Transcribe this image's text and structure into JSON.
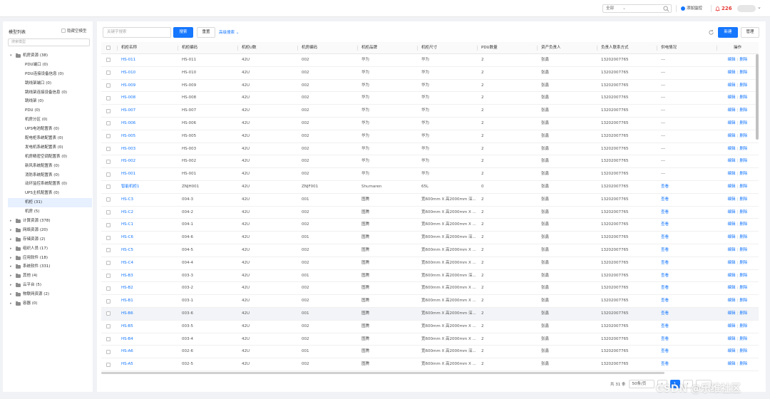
{
  "topbar": {
    "select_label": "全部",
    "add_label": "添加监控",
    "alarm_count": "226",
    "colors": {
      "accent": "#1677ff",
      "alarm": "#e53935"
    }
  },
  "left": {
    "title": "模型列表",
    "hide_empty": "隐藏空模型",
    "search_placeholder": "搜索模型",
    "tree": [
      {
        "label": "机房资源 (38)",
        "level": 0,
        "expanded": true
      },
      {
        "label": "PDU端口 (0)",
        "level": 1
      },
      {
        "label": "PDU连接设备信息 (0)",
        "level": 1
      },
      {
        "label": "跳线架端口 (0)",
        "level": 1
      },
      {
        "label": "跳线架连接设备信息 (0)",
        "level": 1
      },
      {
        "label": "跳线架 (0)",
        "level": 1
      },
      {
        "label": "PDU (0)",
        "level": 1
      },
      {
        "label": "机房分区 (0)",
        "level": 1
      },
      {
        "label": "UPS电池配置表 (0)",
        "level": 1
      },
      {
        "label": "配电柜系统配置表 (0)",
        "level": 1
      },
      {
        "label": "发电机系统配置表 (0)",
        "level": 1
      },
      {
        "label": "机房精密空调配置表 (0)",
        "level": 1
      },
      {
        "label": "新风系统配置表 (0)",
        "level": 1
      },
      {
        "label": "消防系统配置表 (0)",
        "level": 1
      },
      {
        "label": "动环监控系统配置表 (0)",
        "level": 1
      },
      {
        "label": "UPS主机配置表 (0)",
        "level": 1
      },
      {
        "label": "机柜 (31)",
        "level": 1,
        "selected": true
      },
      {
        "label": "机房 (5)",
        "level": 1
      },
      {
        "label": "计算资源 (378)",
        "level": 0
      },
      {
        "label": "网络资源 (20)",
        "level": 0
      },
      {
        "label": "存储资源 (2)",
        "level": 0
      },
      {
        "label": "组织人员 (17)",
        "level": 0
      },
      {
        "label": "应用软件 (18)",
        "level": 0
      },
      {
        "label": "系统软件 (331)",
        "level": 0
      },
      {
        "label": "其他 (4)",
        "level": 0
      },
      {
        "label": "云平台 (5)",
        "level": 0
      },
      {
        "label": "物联网资源 (2)",
        "level": 0
      },
      {
        "label": "容器 (0)",
        "level": 0
      }
    ]
  },
  "main": {
    "keyword_placeholder": "关键字搜索",
    "search_button": "搜索",
    "reset_button": "重置",
    "advanced_search": "高级搜索",
    "new_button": "新建",
    "manage_button": "管理",
    "columns": [
      "机柜名称",
      "机柜编码",
      "机柜U数",
      "机房编码",
      "机柜品牌",
      "机柜尺寸",
      "PDU数量",
      "资产负责人",
      "负责人联系方式",
      "供电情况",
      "操作"
    ],
    "op_edit": "编辑",
    "op_delete": "删除",
    "op_view": "查看",
    "rows": [
      {
        "name": "HS-011",
        "code": "HS-011",
        "u": "42U",
        "room": "002",
        "brand": "华为",
        "size": "华为",
        "pdu": "2",
        "owner": "张鑫",
        "phone": "13202007765",
        "power": "---",
        "ops": "edit"
      },
      {
        "name": "HS-010",
        "code": "HS-010",
        "u": "42U",
        "room": "002",
        "brand": "华为",
        "size": "华为",
        "pdu": "2",
        "owner": "张鑫",
        "phone": "13202007765",
        "power": "---",
        "ops": "edit"
      },
      {
        "name": "HS-009",
        "code": "HS-009",
        "u": "42U",
        "room": "002",
        "brand": "华为",
        "size": "华为",
        "pdu": "2",
        "owner": "张鑫",
        "phone": "13202007765",
        "power": "---",
        "ops": "edit"
      },
      {
        "name": "HS-008",
        "code": "HS-008",
        "u": "42U",
        "room": "002",
        "brand": "华为",
        "size": "华为",
        "pdu": "2",
        "owner": "张鑫",
        "phone": "13202007765",
        "power": "---",
        "ops": "edit"
      },
      {
        "name": "HS-007",
        "code": "HS-007",
        "u": "42U",
        "room": "002",
        "brand": "华为",
        "size": "华为",
        "pdu": "2",
        "owner": "张鑫",
        "phone": "13202007765",
        "power": "---",
        "ops": "edit"
      },
      {
        "name": "HS-006",
        "code": "HS-006",
        "u": "42U",
        "room": "002",
        "brand": "华为",
        "size": "华为",
        "pdu": "2",
        "owner": "张鑫",
        "phone": "13202007765",
        "power": "---",
        "ops": "edit"
      },
      {
        "name": "HS-005",
        "code": "HS-005",
        "u": "42U",
        "room": "002",
        "brand": "华为",
        "size": "华为",
        "pdu": "2",
        "owner": "张鑫",
        "phone": "13202007765",
        "power": "---",
        "ops": "edit"
      },
      {
        "name": "HS-003",
        "code": "HS-003",
        "u": "42U",
        "room": "002",
        "brand": "华为",
        "size": "华为",
        "pdu": "2",
        "owner": "张鑫",
        "phone": "13202007765",
        "power": "---",
        "ops": "edit"
      },
      {
        "name": "HS-002",
        "code": "HS-002",
        "u": "42U",
        "room": "002",
        "brand": "华为",
        "size": "华为",
        "pdu": "2",
        "owner": "张鑫",
        "phone": "13202007765",
        "power": "---",
        "ops": "edit"
      },
      {
        "name": "HS-001",
        "code": "HS-001",
        "u": "42U",
        "room": "002",
        "brand": "华为",
        "size": "华为",
        "pdu": "2",
        "owner": "张鑫",
        "phone": "13202007765",
        "power": "---",
        "ops": "edit"
      },
      {
        "name": "智能机柜1",
        "code": "ZNJH001",
        "u": "42U",
        "room": "ZNJF001",
        "brand": "Shumaren",
        "size": "65L",
        "pdu": "0",
        "owner": "张鑫",
        "phone": "13202007765",
        "power": "查看",
        "ops": "edit"
      },
      {
        "name": "HS-C3",
        "code": "004-3",
        "u": "42U",
        "room": "001",
        "brand": "图腾",
        "size": "宽600mm X 高2000mm 深...",
        "pdu": "2",
        "owner": "张鑫",
        "phone": "13202007765",
        "power": "查看",
        "ops": "edit"
      },
      {
        "name": "HS-C2",
        "code": "004-2",
        "u": "42U",
        "room": "002",
        "brand": "图腾",
        "size": "宽600mm X 高2000mm X ...",
        "pdu": "2",
        "owner": "张鑫",
        "phone": "13202007765",
        "power": "查看",
        "ops": "edit"
      },
      {
        "name": "HS-C1",
        "code": "004-1",
        "u": "42U",
        "room": "002",
        "brand": "图腾",
        "size": "宽600mm X 高2000mm X ...",
        "pdu": "2",
        "owner": "张鑫",
        "phone": "13202007765",
        "power": "查看",
        "ops": "edit"
      },
      {
        "name": "HS-C6",
        "code": "004-6",
        "u": "42U",
        "room": "001",
        "brand": "图腾",
        "size": "宽600mm X 高2000mm 深...",
        "pdu": "2",
        "owner": "张鑫",
        "phone": "13202007765",
        "power": "查看",
        "ops": "edit"
      },
      {
        "name": "HS-C5",
        "code": "004-5",
        "u": "42U",
        "room": "002",
        "brand": "图腾",
        "size": "宽600mm X 高2000mm X ...",
        "pdu": "2",
        "owner": "张鑫",
        "phone": "13202007765",
        "power": "查看",
        "ops": "edit"
      },
      {
        "name": "HS-C4",
        "code": "004-4",
        "u": "42U",
        "room": "002",
        "brand": "图腾",
        "size": "宽600mm X 高2000mm X ...",
        "pdu": "2",
        "owner": "张鑫",
        "phone": "13202007765",
        "power": "查看",
        "ops": "edit"
      },
      {
        "name": "HS-B3",
        "code": "003-3",
        "u": "42U",
        "room": "001",
        "brand": "图腾",
        "size": "宽600mm X 高2000mm 深...",
        "pdu": "2",
        "owner": "张鑫",
        "phone": "13202007765",
        "power": "查看",
        "ops": "edit"
      },
      {
        "name": "HS-B2",
        "code": "003-2",
        "u": "42U",
        "room": "002",
        "brand": "图腾",
        "size": "宽600mm X 高2000mm X ...",
        "pdu": "2",
        "owner": "张鑫",
        "phone": "13202007765",
        "power": "查看",
        "ops": "edit"
      },
      {
        "name": "HS-B1",
        "code": "003-1",
        "u": "42U",
        "room": "002",
        "brand": "图腾",
        "size": "宽600mm X 高2000mm X ...",
        "pdu": "2",
        "owner": "张鑫",
        "phone": "13202007765",
        "power": "查看",
        "ops": "edit"
      },
      {
        "name": "HS-B6",
        "code": "003-6",
        "u": "42U",
        "room": "001",
        "brand": "图腾",
        "size": "宽600mm X 高2000mm 深...",
        "pdu": "2",
        "owner": "张鑫",
        "phone": "13202007765",
        "power": "查看",
        "ops": "edit",
        "highlight": true
      },
      {
        "name": "HS-B5",
        "code": "003-5",
        "u": "42U",
        "room": "002",
        "brand": "图腾",
        "size": "宽600mm X 高2000mm X ...",
        "pdu": "2",
        "owner": "张鑫",
        "phone": "13202007765",
        "power": "查看",
        "ops": "edit"
      },
      {
        "name": "HS-B4",
        "code": "003-4",
        "u": "42U",
        "room": "002",
        "brand": "图腾",
        "size": "宽600mm X 高2000mm X ...",
        "pdu": "2",
        "owner": "张鑫",
        "phone": "13202007765",
        "power": "查看",
        "ops": "edit"
      },
      {
        "name": "HS-A6",
        "code": "002-6",
        "u": "42U",
        "room": "001",
        "brand": "图腾",
        "size": "宽600mm X 高2000mm 深...",
        "pdu": "2",
        "owner": "张鑫",
        "phone": "13202007765",
        "power": "查看",
        "ops": "edit"
      },
      {
        "name": "HS-A5",
        "code": "002-5",
        "u": "42U",
        "room": "002",
        "brand": "图腾",
        "size": "宽600mm X 高2000mm X ...",
        "pdu": "2",
        "owner": "张鑫",
        "phone": "13202007765",
        "power": "查看",
        "ops": "edit"
      }
    ]
  },
  "pager": {
    "total": "共 31 条",
    "size": "50条/页",
    "current": "1"
  },
  "watermark": "CSDN @乐维社区"
}
